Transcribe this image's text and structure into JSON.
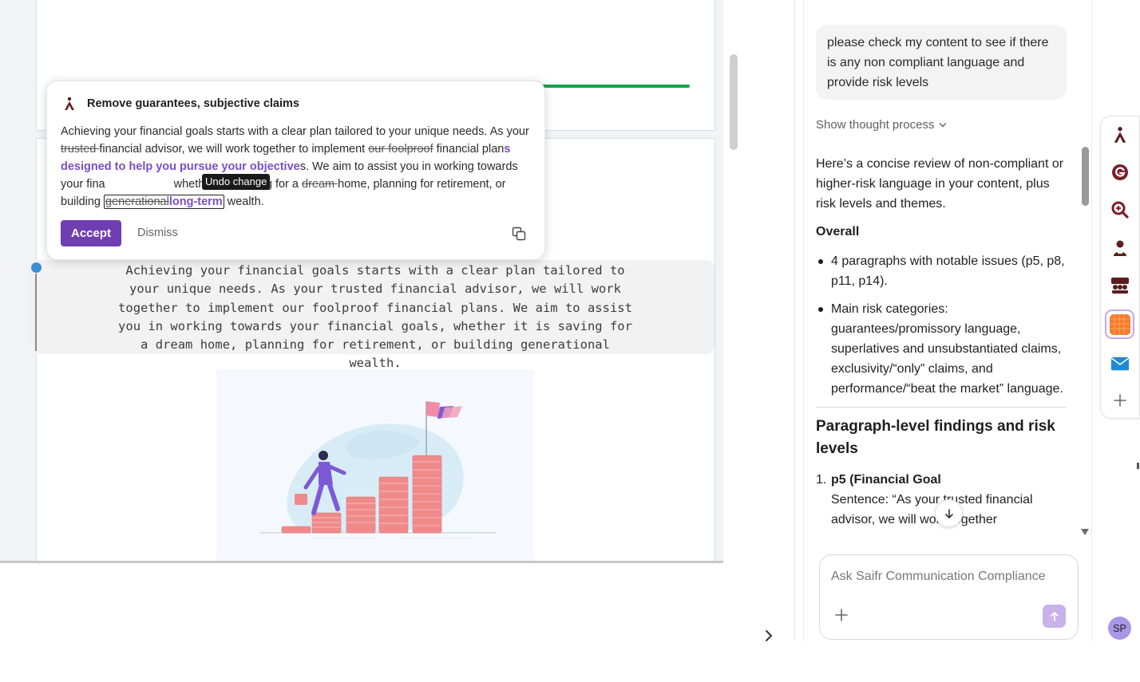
{
  "popup": {
    "title": "Remove guarantees, subjective claims",
    "body": {
      "p1": "Achieving your financial goals starts with a clear plan tailored to your unique needs. As your ",
      "del1": "trusted ",
      "p2": "financial advisor, we will work together to implement ",
      "del2": "our foolproof",
      "p3": " financial plan",
      "ins1": "s designed to help you pursue your objective",
      "p4": "s. We aim to assist you in working towards your fina",
      "p5": "whether it is saving for a ",
      "del3": "dream ",
      "p6": "home, planning for retirement, or building ",
      "del4": "generational",
      "ins2": "long-term",
      "p7": " wealth."
    },
    "tooltip": "Undo change",
    "accept_label": "Accept",
    "dismiss_label": "Dismiss"
  },
  "document": {
    "paragraph": "Achieving your financial goals starts with a clear plan tailored to your unique needs. As your trusted financial advisor, we will work together to implement our foolproof financial plans. We aim to assist you in working towards your financial goals, whether it is saving for a dream home, planning for retirement, or building generational wealth."
  },
  "chat": {
    "user_message": "please check my content to see if there is any non compliant language and provide risk levels",
    "show_thought_label": "Show thought process",
    "intro": "Here’s a concise review of non-compliant or higher-risk language in your content, plus risk levels and themes.",
    "overall_heading": "Overall",
    "bullets": [
      "4 paragraphs with notable issues (p5, p8, p11, p14).",
      "Main risk categories: guarantees/promissory language, superlatives and unsubstantiated claims, exclusivity/“only” claims, and performance/“beat the market” language."
    ],
    "findings_heading": "Paragraph-level findings and risk levels",
    "finding_1": {
      "number": "1.",
      "title": "p5 (Financial Goal",
      "sentence": "Sentence: “As your trusted financial advisor, we will work together"
    },
    "input_placeholder": "Ask Saifr Communication Compliance"
  },
  "user": {
    "initials": "SP"
  },
  "colors": {
    "accent_purple": "#6f3fb1",
    "insert_purple": "#7c4dc4",
    "progress_green": "#16a34a",
    "send_button": "#c9b1ea"
  },
  "sidebar_icons": [
    "saifr-icon",
    "grammarly-icon",
    "zoom-search-icon",
    "person-icon",
    "team-icon",
    "orange-app-icon",
    "mail-icon",
    "add-icon"
  ]
}
